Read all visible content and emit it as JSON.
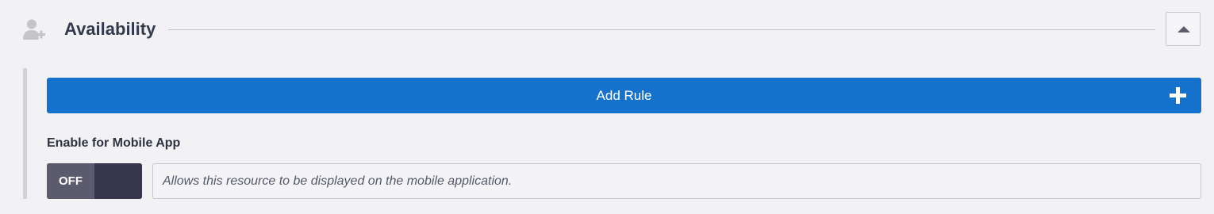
{
  "section": {
    "title": "Availability",
    "icon": "user-plus-icon",
    "collapse_icon": "caret-up-icon"
  },
  "add_rule": {
    "label": "Add Rule",
    "icon": "plus-icon"
  },
  "mobile": {
    "label": "Enable for Mobile App",
    "toggle_state": "OFF",
    "description": "Allows this resource to be displayed on the mobile application."
  },
  "colors": {
    "background": "#f2f2f4",
    "primary_button": "#1472cc",
    "toggle_off": "#5c5b6e",
    "toggle_track": "#36364c",
    "title_text": "#343a4e"
  }
}
